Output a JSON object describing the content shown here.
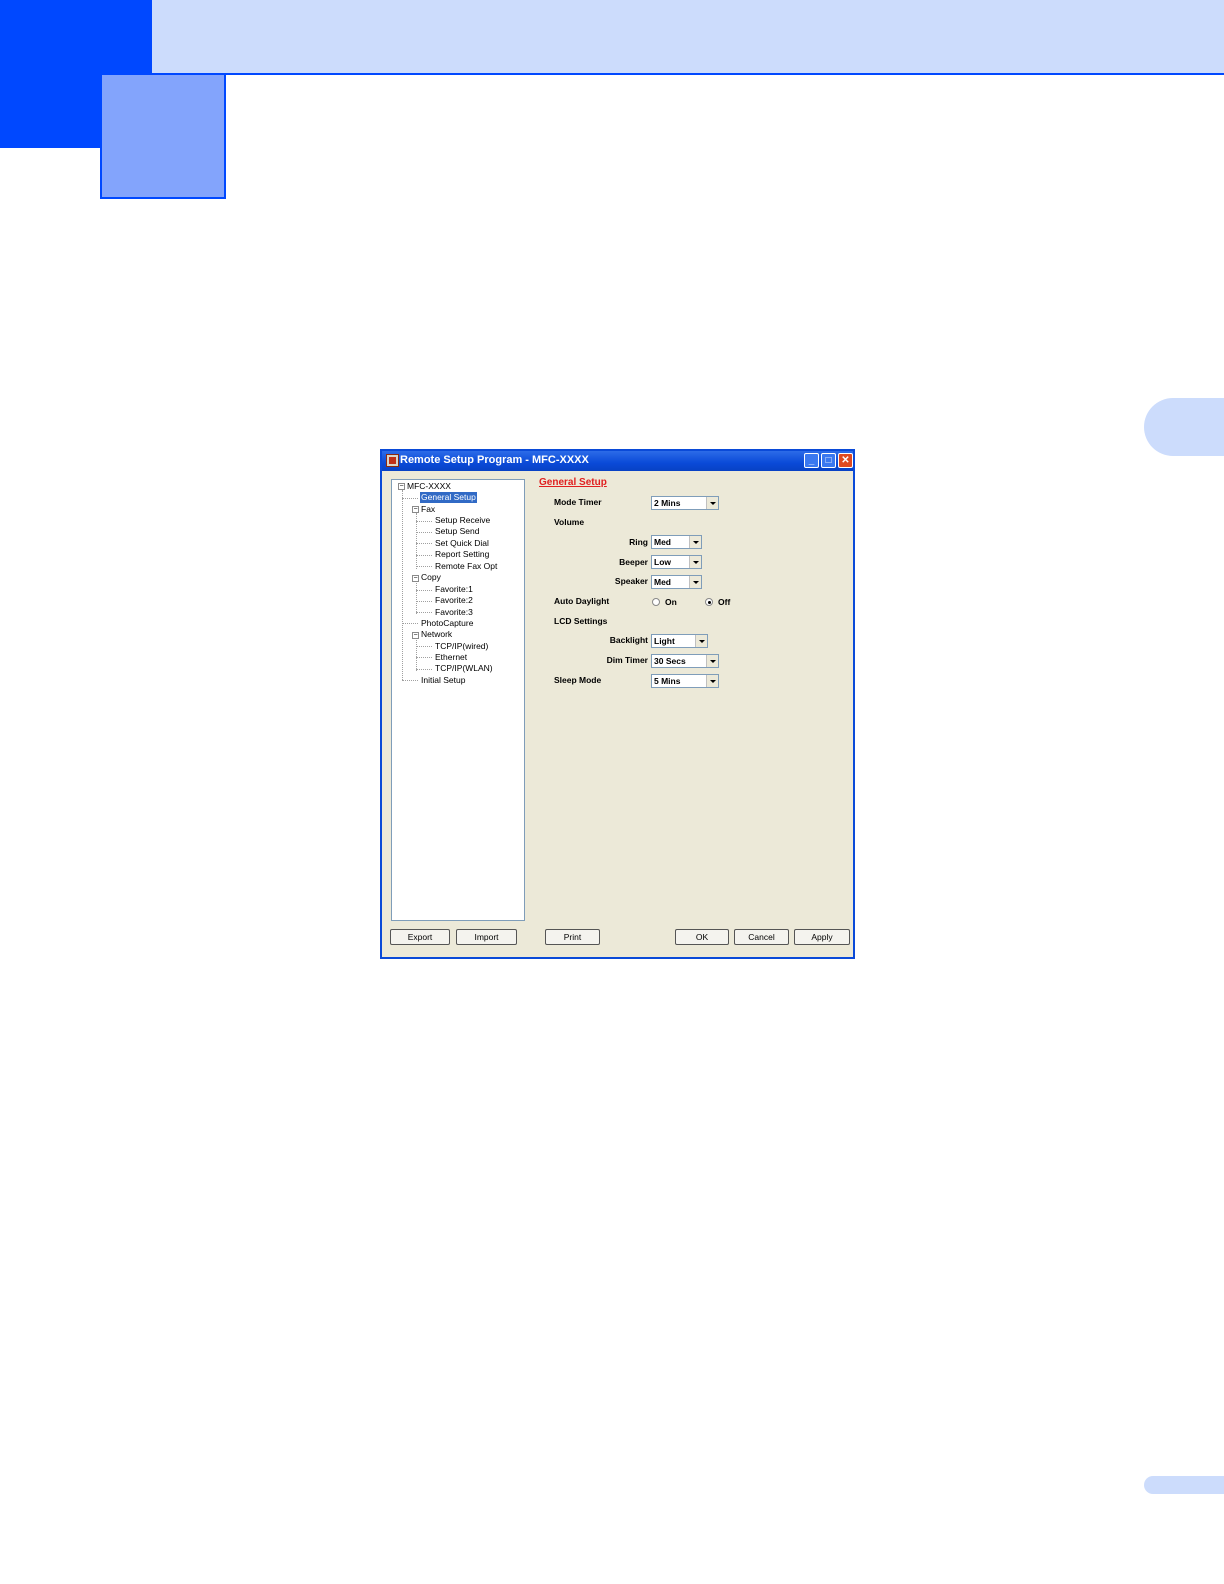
{
  "window": {
    "title": "Remote Setup Program - MFC-XXXX",
    "minimize": "_",
    "maximize": "□",
    "close": "✕"
  },
  "tree": {
    "root": "MFC-XXXX",
    "items": [
      {
        "label": "General Setup",
        "selected": true
      },
      {
        "label": "Fax"
      },
      {
        "label": "Setup Receive"
      },
      {
        "label": "Setup Send"
      },
      {
        "label": "Set Quick Dial"
      },
      {
        "label": "Report Setting"
      },
      {
        "label": "Remote Fax Opt"
      },
      {
        "label": "Copy"
      },
      {
        "label": "Favorite:1"
      },
      {
        "label": "Favorite:2"
      },
      {
        "label": "Favorite:3"
      },
      {
        "label": "PhotoCapture"
      },
      {
        "label": "Network"
      },
      {
        "label": "TCP/IP(wired)"
      },
      {
        "label": "Ethernet"
      },
      {
        "label": "TCP/IP(WLAN)"
      },
      {
        "label": "Initial Setup"
      }
    ],
    "expander_symbol": "−"
  },
  "panel": {
    "title": "General Setup",
    "mode_timer": {
      "label": "Mode Timer",
      "value": "2 Mins"
    },
    "volume_label": "Volume",
    "ring": {
      "label": "Ring",
      "value": "Med"
    },
    "beeper": {
      "label": "Beeper",
      "value": "Low"
    },
    "speaker": {
      "label": "Speaker",
      "value": "Med"
    },
    "auto_daylight": {
      "label": "Auto Daylight",
      "on": "On",
      "off": "Off",
      "selected": "Off"
    },
    "lcd_label": "LCD Settings",
    "backlight": {
      "label": "Backlight",
      "value": "Light"
    },
    "dim_timer": {
      "label": "Dim Timer",
      "value": "30 Secs"
    },
    "sleep_mode": {
      "label": "Sleep Mode",
      "value": "5 Mins"
    }
  },
  "buttons": {
    "export": "Export",
    "import": "Import",
    "print": "Print",
    "ok": "OK",
    "cancel": "Cancel",
    "apply": "Apply"
  },
  "colors": {
    "accent": "#0048ff",
    "band": "#ccdcfc",
    "chapter": "#83a4fc",
    "panel_title": "#e02020"
  }
}
